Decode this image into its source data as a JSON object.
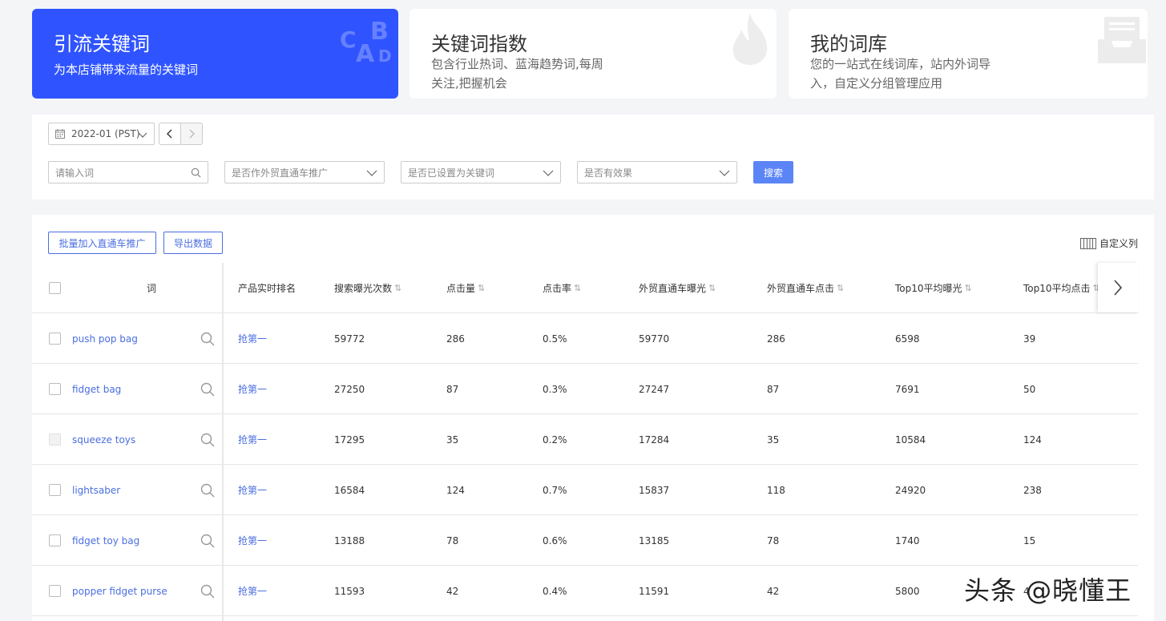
{
  "cards": [
    {
      "title": "引流关键词",
      "desc": "为本店铺带来流量的关键词"
    },
    {
      "title": "关键词指数",
      "desc": "包含行业热词、蓝海趋势词,每周关注,把握机会"
    },
    {
      "title": "我的词库",
      "desc": "您的一站式在线词库，站内外词导入，自定义分组管理应用"
    }
  ],
  "card_icon_letters": {
    "c": "C",
    "a": "A",
    "b": "B",
    "d": "D"
  },
  "filters": {
    "date": "2022-01 (PST)",
    "search_placeholder": "请输入词",
    "select1": "是否作外贸直通车推广",
    "select2": "是否已设置为关键词",
    "select3": "是否有效果",
    "search_button": "搜索"
  },
  "toolbar": {
    "batch_add": "批量加入直通车推广",
    "export": "导出数据",
    "custom_columns": "自定义列"
  },
  "columns": {
    "word": "词",
    "rank": "产品实时排名",
    "impressions": "搜索曝光次数",
    "clicks": "点击量",
    "ctr": "点击率",
    "p4p_impressions": "外贸直通车曝光",
    "p4p_clicks": "外贸直通车点击",
    "top10_impressions": "Top10平均曝光",
    "top10_clicks": "Top10平均点击"
  },
  "rows": [
    {
      "word": "push pop bag",
      "rank": "抢第一",
      "impressions": "59772",
      "clicks": "286",
      "ctr": "0.5%",
      "p4p_impressions": "59770",
      "p4p_clicks": "286",
      "top10_impressions": "6598",
      "top10_clicks": "39",
      "checkbox_disabled": false
    },
    {
      "word": "fidget bag",
      "rank": "抢第一",
      "impressions": "27250",
      "clicks": "87",
      "ctr": "0.3%",
      "p4p_impressions": "27247",
      "p4p_clicks": "87",
      "top10_impressions": "7691",
      "top10_clicks": "50",
      "checkbox_disabled": false
    },
    {
      "word": "squeeze toys",
      "rank": "抢第一",
      "impressions": "17295",
      "clicks": "35",
      "ctr": "0.2%",
      "p4p_impressions": "17284",
      "p4p_clicks": "35",
      "top10_impressions": "10584",
      "top10_clicks": "124",
      "checkbox_disabled": true
    },
    {
      "word": "lightsaber",
      "rank": "抢第一",
      "impressions": "16584",
      "clicks": "124",
      "ctr": "0.7%",
      "p4p_impressions": "15837",
      "p4p_clicks": "118",
      "top10_impressions": "24920",
      "top10_clicks": "238",
      "checkbox_disabled": false
    },
    {
      "word": "fidget toy bag",
      "rank": "抢第一",
      "impressions": "13188",
      "clicks": "78",
      "ctr": "0.6%",
      "p4p_impressions": "13185",
      "p4p_clicks": "78",
      "top10_impressions": "1740",
      "top10_clicks": "15",
      "checkbox_disabled": false
    },
    {
      "word": "popper fidget purse",
      "rank": "抢第一",
      "impressions": "11593",
      "clicks": "42",
      "ctr": "0.4%",
      "p4p_impressions": "11591",
      "p4p_clicks": "42",
      "top10_impressions": "5800",
      "top10_clicks": "4",
      "checkbox_disabled": false
    }
  ],
  "watermark": "头条 @晓懂王",
  "colors": {
    "accent": "#2f54ff",
    "link": "#4a6ee0",
    "button": "#5b85f6"
  }
}
